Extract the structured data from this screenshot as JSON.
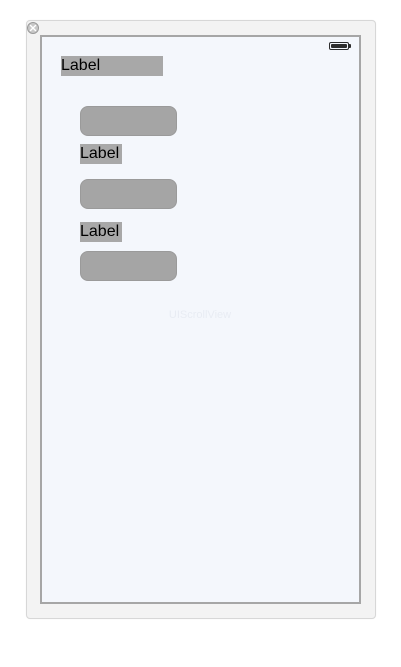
{
  "screen": {
    "watermark": "UIScrollView",
    "top_label": "Label",
    "form": {
      "label_1": "Label",
      "label_2": "Label",
      "fields": [
        {
          "value": ""
        },
        {
          "value": ""
        },
        {
          "value": ""
        }
      ]
    }
  },
  "status_bar": {
    "battery_icon": "battery-full-icon",
    "battery_level": 1.0
  },
  "window": {
    "close_icon": "close-icon"
  },
  "colors": {
    "screen_background": "#f4f7fc",
    "placeholder_gray": "#a8a8a8",
    "frame_background": "#f3f3f3",
    "frame_border": "#a6a6a6"
  }
}
